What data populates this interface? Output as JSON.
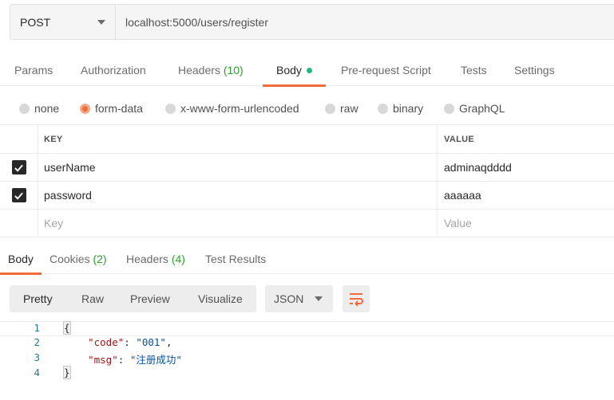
{
  "request": {
    "method": "POST",
    "url": "localhost:5000/users/register"
  },
  "request_tabs": {
    "params": "Params",
    "authorization": "Authorization",
    "headers": "Headers",
    "headers_count": "(10)",
    "body": "Body",
    "prerequest": "Pre-request Script",
    "tests": "Tests",
    "settings": "Settings"
  },
  "body_types": {
    "none": "none",
    "form_data": "form-data",
    "urlencoded": "x-www-form-urlencoded",
    "raw": "raw",
    "binary": "binary",
    "graphql": "GraphQL",
    "selected": "form-data"
  },
  "kv_table": {
    "key_header": "KEY",
    "value_header": "VALUE",
    "rows": [
      {
        "key": "userName",
        "value": "adminaqdddd",
        "checked": true
      },
      {
        "key": "password",
        "value": "aaaaaa",
        "checked": true
      }
    ],
    "key_placeholder": "Key",
    "value_placeholder": "Value"
  },
  "response_tabs": {
    "body": "Body",
    "cookies": "Cookies",
    "cookies_count": "(2)",
    "headers": "Headers",
    "headers_count": "(4)",
    "test_results": "Test Results"
  },
  "view": {
    "pretty": "Pretty",
    "raw": "Raw",
    "preview": "Preview",
    "visualize": "Visualize",
    "format": "JSON"
  },
  "response_body": {
    "lines": [
      "1",
      "2",
      "3",
      "4"
    ],
    "open_brace": "{",
    "key1": "\"code\"",
    "value1": "\"001\"",
    "key2": "\"msg\"",
    "value2": "\"注册成功\"",
    "close_brace": "}"
  },
  "colors": {
    "accent": "#f26b3a",
    "green": "#29a329",
    "dot": "#26b47f"
  }
}
